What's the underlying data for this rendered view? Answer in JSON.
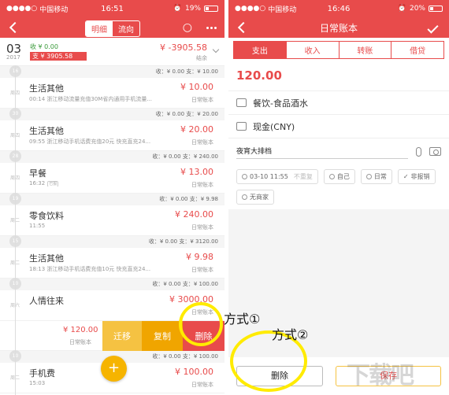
{
  "left": {
    "status": {
      "carrier": "中国移动",
      "time": "16:51",
      "battery": "19%"
    },
    "nav": {
      "tab_detail": "明细",
      "tab_flow": "流向"
    },
    "month": {
      "day": "03",
      "year": "2017",
      "income": "收 ¥ 0.00",
      "expense": "支 ¥ 3905.58",
      "total": "¥ -3905.58",
      "sub": "结余"
    },
    "days": [
      {
        "dot": "16",
        "summary": "收：¥ 0.00  支：¥ 10.00"
      },
      {
        "dot": "30",
        "summary": "收：¥ 0.00  支：¥ 20.00"
      },
      {
        "dot": "28",
        "summary": "收：¥ 0.00  支：¥ 240.00"
      },
      {
        "dot": "19",
        "summary": "收：¥ 0.00  支：¥ 9.98"
      },
      {
        "dot": "15",
        "summary": "收：¥ 0.00  支：¥ 3120.00"
      },
      {
        "dot": "10",
        "summary": "收：¥ 0.00  支：¥ 100.00"
      }
    ],
    "entries": [
      {
        "weekday": "周四",
        "category": "生活其他",
        "note": "00:14 浙江移动流量充值30M省内通用手机流量...",
        "amount": "¥ 10.00",
        "book": "日常账本"
      },
      {
        "weekday": "周四",
        "category": "生活其他",
        "note": "09:55 浙江移动手机话费充值20元 快充直充24...",
        "amount": "¥ 20.00",
        "book": "日常账本"
      },
      {
        "weekday": "周四",
        "category": "早餐",
        "note": "16:32",
        "amount": "¥ 13.00",
        "book": "日常账本"
      },
      {
        "weekday": "周二",
        "category": "零食饮料",
        "note": "11:55",
        "amount": "¥ 240.00",
        "book": "日常账本"
      },
      {
        "weekday": "周二",
        "category": "生活其他",
        "note": "18:13 浙江移动手机话费充值10元 快充直充24...",
        "amount": "¥ 9.98",
        "book": "日常账本"
      },
      {
        "weekday": "周六",
        "category": "人情往来",
        "note": "",
        "amount": "¥ 3000.00",
        "book": "日常账本"
      },
      {
        "weekday": "周二",
        "category": "手机费",
        "note": "15:03",
        "amount": "¥ 100.00",
        "book": "日常账本"
      }
    ],
    "entry_tag": "已报",
    "swipe": {
      "amount": "¥ 120.00",
      "book": "日常账本",
      "move": "迁移",
      "copy": "复制",
      "delete": "删除"
    },
    "fab": "+"
  },
  "annotations": {
    "method1": "方式①",
    "method2": "方式②"
  },
  "right": {
    "status": {
      "carrier": "中国移动",
      "time": "16:46",
      "battery": "20%"
    },
    "nav": {
      "title": "日常账本"
    },
    "tabs": [
      "支出",
      "收入",
      "转账",
      "借贷"
    ],
    "amount": "120.00",
    "category": "餐饮-食品酒水",
    "account": "现金(CNY)",
    "memo": "夜宵大排档",
    "chips": {
      "date": "03-10 11:55",
      "repeat": "不重复",
      "member": "自己",
      "tag": "日常",
      "reimburse": "非报销",
      "merchant": "无商家"
    },
    "buttons": {
      "delete": "删除",
      "save": "保存"
    }
  },
  "watermark": "下载吧"
}
